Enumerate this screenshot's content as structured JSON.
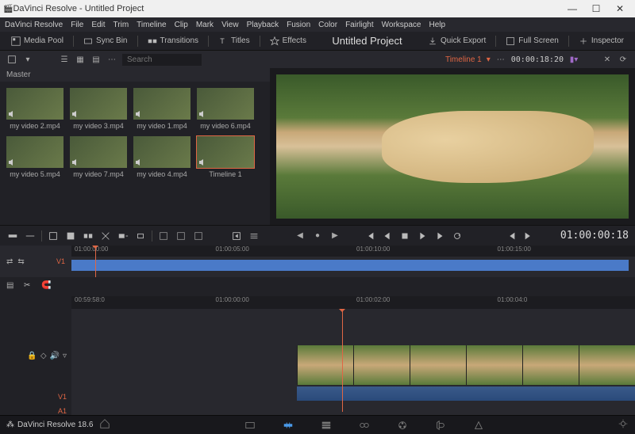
{
  "titlebar": {
    "title": "DaVinci Resolve - Untitled Project"
  },
  "menubar": [
    "DaVinci Resolve",
    "File",
    "Edit",
    "Trim",
    "Timeline",
    "Clip",
    "Mark",
    "View",
    "Playback",
    "Fusion",
    "Color",
    "Fairlight",
    "Workspace",
    "Help"
  ],
  "toolbar": {
    "media_pool": "Media Pool",
    "sync_bin": "Sync Bin",
    "transitions": "Transitions",
    "titles": "Titles",
    "effects": "Effects",
    "project": "Untitled Project",
    "quick_export": "Quick Export",
    "full_screen": "Full Screen",
    "inspector": "Inspector"
  },
  "subtoolbar": {
    "search_placeholder": "Search",
    "timeline_name": "Timeline 1",
    "timecode": "00:00:18:20"
  },
  "master_label": "Master",
  "clips": [
    {
      "label": "my video 2.mp4"
    },
    {
      "label": "my video 3.mp4"
    },
    {
      "label": "my video 1.mp4"
    },
    {
      "label": "my video 6.mp4"
    },
    {
      "label": "my video 5.mp4"
    },
    {
      "label": "my video 7.mp4"
    },
    {
      "label": "my video 4.mp4"
    },
    {
      "label": "Timeline 1",
      "selected": true
    }
  ],
  "transport": {
    "timecode": "01:00:00:18"
  },
  "mini_ruler": [
    "01:00:00:00",
    "01:00:05:00",
    "01:00:10:00",
    "01:00:15:00"
  ],
  "track_labels": {
    "v1": "V1",
    "a1": "A1"
  },
  "tl_ruler": [
    "00:59:58:0",
    "01:00:00:00",
    "01:00:02:00",
    "01:00:04:0"
  ],
  "bottombar": {
    "version": "DaVinci Resolve 18.6"
  }
}
